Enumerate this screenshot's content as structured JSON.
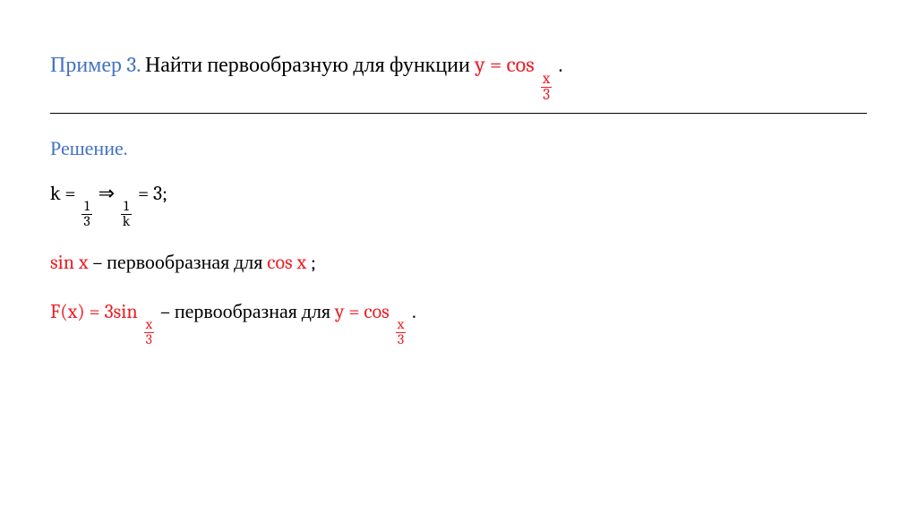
{
  "title": {
    "example_label": "Пример 3.",
    "prompt_text": " Найти первообразную для функции ",
    "func_lhs": "y = cos",
    "func_frac_num": "x",
    "func_frac_den": "3",
    "period": " ."
  },
  "solution_label": "Решение.",
  "line_k": {
    "k_eq": "k = ",
    "frac1_num": "1",
    "frac1_den": "3",
    "arrow": "  ⇒  ",
    "frac2_num": "1",
    "frac2_den": "k",
    "eq3": " = 3;"
  },
  "line_sin": {
    "sinx": "sin x",
    "dash_text": " – первообразная для ",
    "cosx": "cos x",
    "semi": ";"
  },
  "line_F": {
    "F_eq": "F(x) = 3sin",
    "frac_num": "x",
    "frac_den": "3",
    "dash_text": "  – первообразная для  ",
    "y_eq": "y = cos",
    "frac2_num": "x",
    "frac2_den": "3",
    "period": " ."
  }
}
